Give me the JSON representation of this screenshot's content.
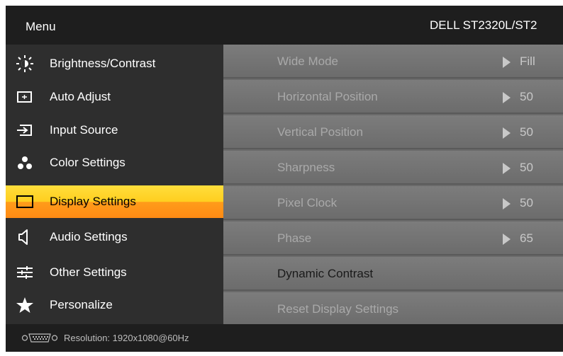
{
  "header": {
    "menu_title": "Menu",
    "model": "DELL  ST2320L/ST2"
  },
  "sidebar": {
    "items": [
      {
        "label": "Brightness/Contrast",
        "icon": "brightness-icon",
        "selected": false
      },
      {
        "label": "Auto Adjust",
        "icon": "auto-adjust-icon",
        "selected": false
      },
      {
        "label": "Input Source",
        "icon": "input-source-icon",
        "selected": false
      },
      {
        "label": "Color Settings",
        "icon": "color-settings-icon",
        "selected": false
      },
      {
        "label": "Display Settings",
        "icon": "display-settings-icon",
        "selected": true
      },
      {
        "label": "Audio Settings",
        "icon": "speaker-icon",
        "selected": false
      },
      {
        "label": "Other Settings",
        "icon": "sliders-icon",
        "selected": false
      },
      {
        "label": "Personalize",
        "icon": "star-icon",
        "selected": false
      }
    ]
  },
  "content": {
    "rows": [
      {
        "label": "Wide Mode",
        "value": "Fill"
      },
      {
        "label": "Horizontal Position",
        "value": "50"
      },
      {
        "label": "Vertical Position",
        "value": "50"
      },
      {
        "label": "Sharpness",
        "value": "50"
      },
      {
        "label": "Pixel Clock",
        "value": "50"
      },
      {
        "label": "Phase",
        "value": "65"
      },
      {
        "label": "Dynamic Contrast",
        "value": null
      },
      {
        "label": "Reset Display Settings",
        "value": null
      }
    ]
  },
  "footer": {
    "resolution": "Resolution:  1920x1080@60Hz",
    "connector_icon": "vga-connector-icon"
  },
  "colors": {
    "selected_top": "#ffde3c",
    "selected_bottom": "#ff8a14",
    "panel_bg": "#2e2e2e",
    "content_bg": "#757575"
  }
}
